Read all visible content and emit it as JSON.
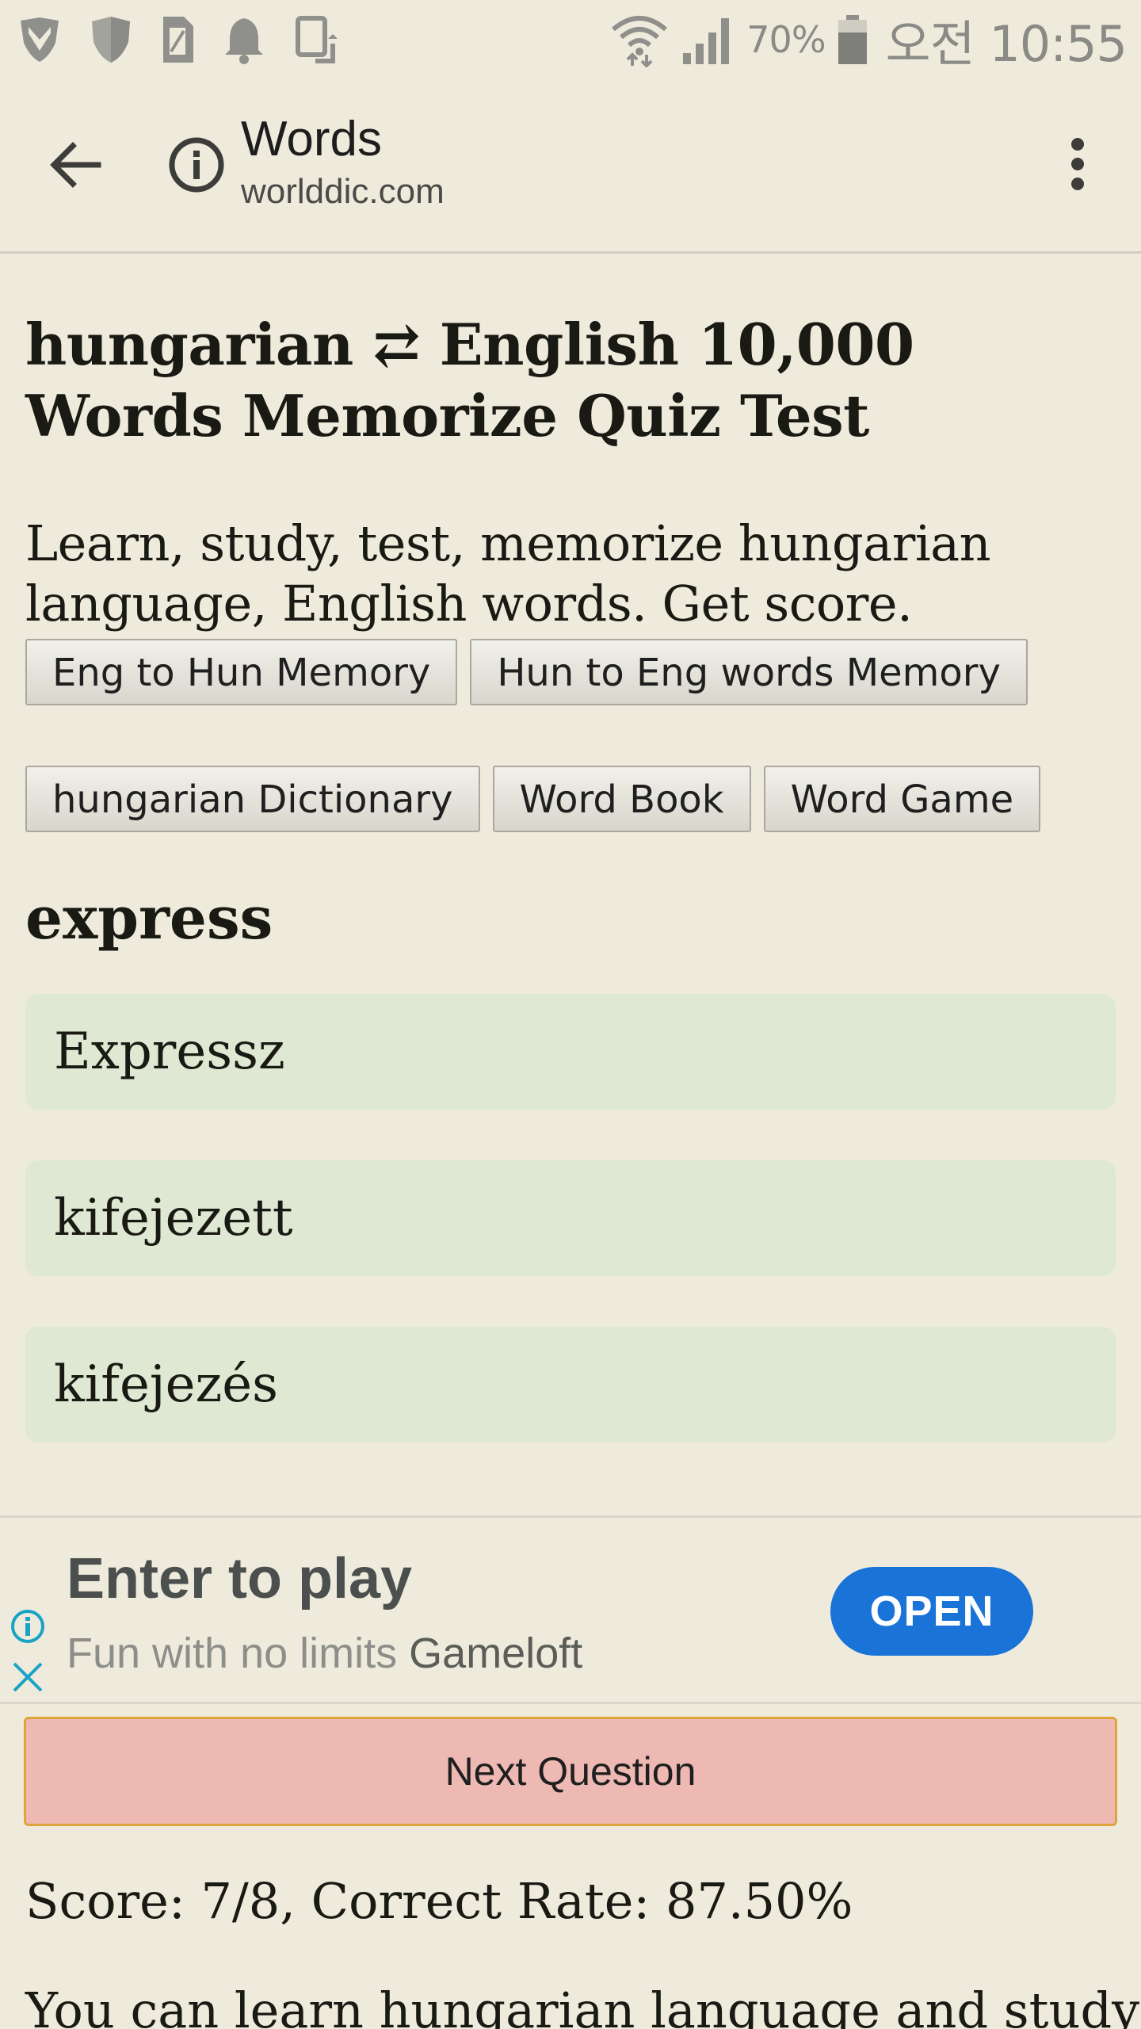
{
  "status_bar": {
    "battery_percent": "70%",
    "clock": "오전 10:55",
    "icons": [
      "vpn-shield-icon",
      "shield-icon",
      "sim-card-icon",
      "bell-icon",
      "screen-rotate-icon",
      "wifi-icon",
      "signal-icon",
      "battery-icon"
    ]
  },
  "toolbar": {
    "title": "Words",
    "domain": "worlddic.com",
    "icons": [
      "back-arrow-icon",
      "info-icon",
      "more-vert-icon"
    ]
  },
  "main": {
    "heading": "hungarian ⇄ English 10,000 Words Memorize Quiz Test",
    "intro": "Learn, study, test, memorize hungarian language, English words. Get score.",
    "buttons_row1": [
      "Eng to Hun Memory",
      "Hun to Eng words Memory"
    ],
    "buttons_row2": [
      "hungarian Dictionary",
      "Word Book",
      "Word Game"
    ],
    "question_word": "express",
    "answers": [
      "Expressz",
      "kifejezett",
      "kifejezés"
    ]
  },
  "ad": {
    "title": "Enter to play",
    "subtitle": "Fun with no limits",
    "brand": "Gameloft",
    "open_label": "OPEN",
    "accent": "#1a73d7"
  },
  "next_question_label": "Next Question",
  "score_text": "Score: 7/8, Correct Rate: 87.50%",
  "footer_text": "You can learn hungarian language and study",
  "colors": {
    "background": "#efebdc",
    "answer_bg": "#dee8d2",
    "next_btn_bg": "#eeb8b3",
    "next_btn_border": "#e0a53a"
  }
}
